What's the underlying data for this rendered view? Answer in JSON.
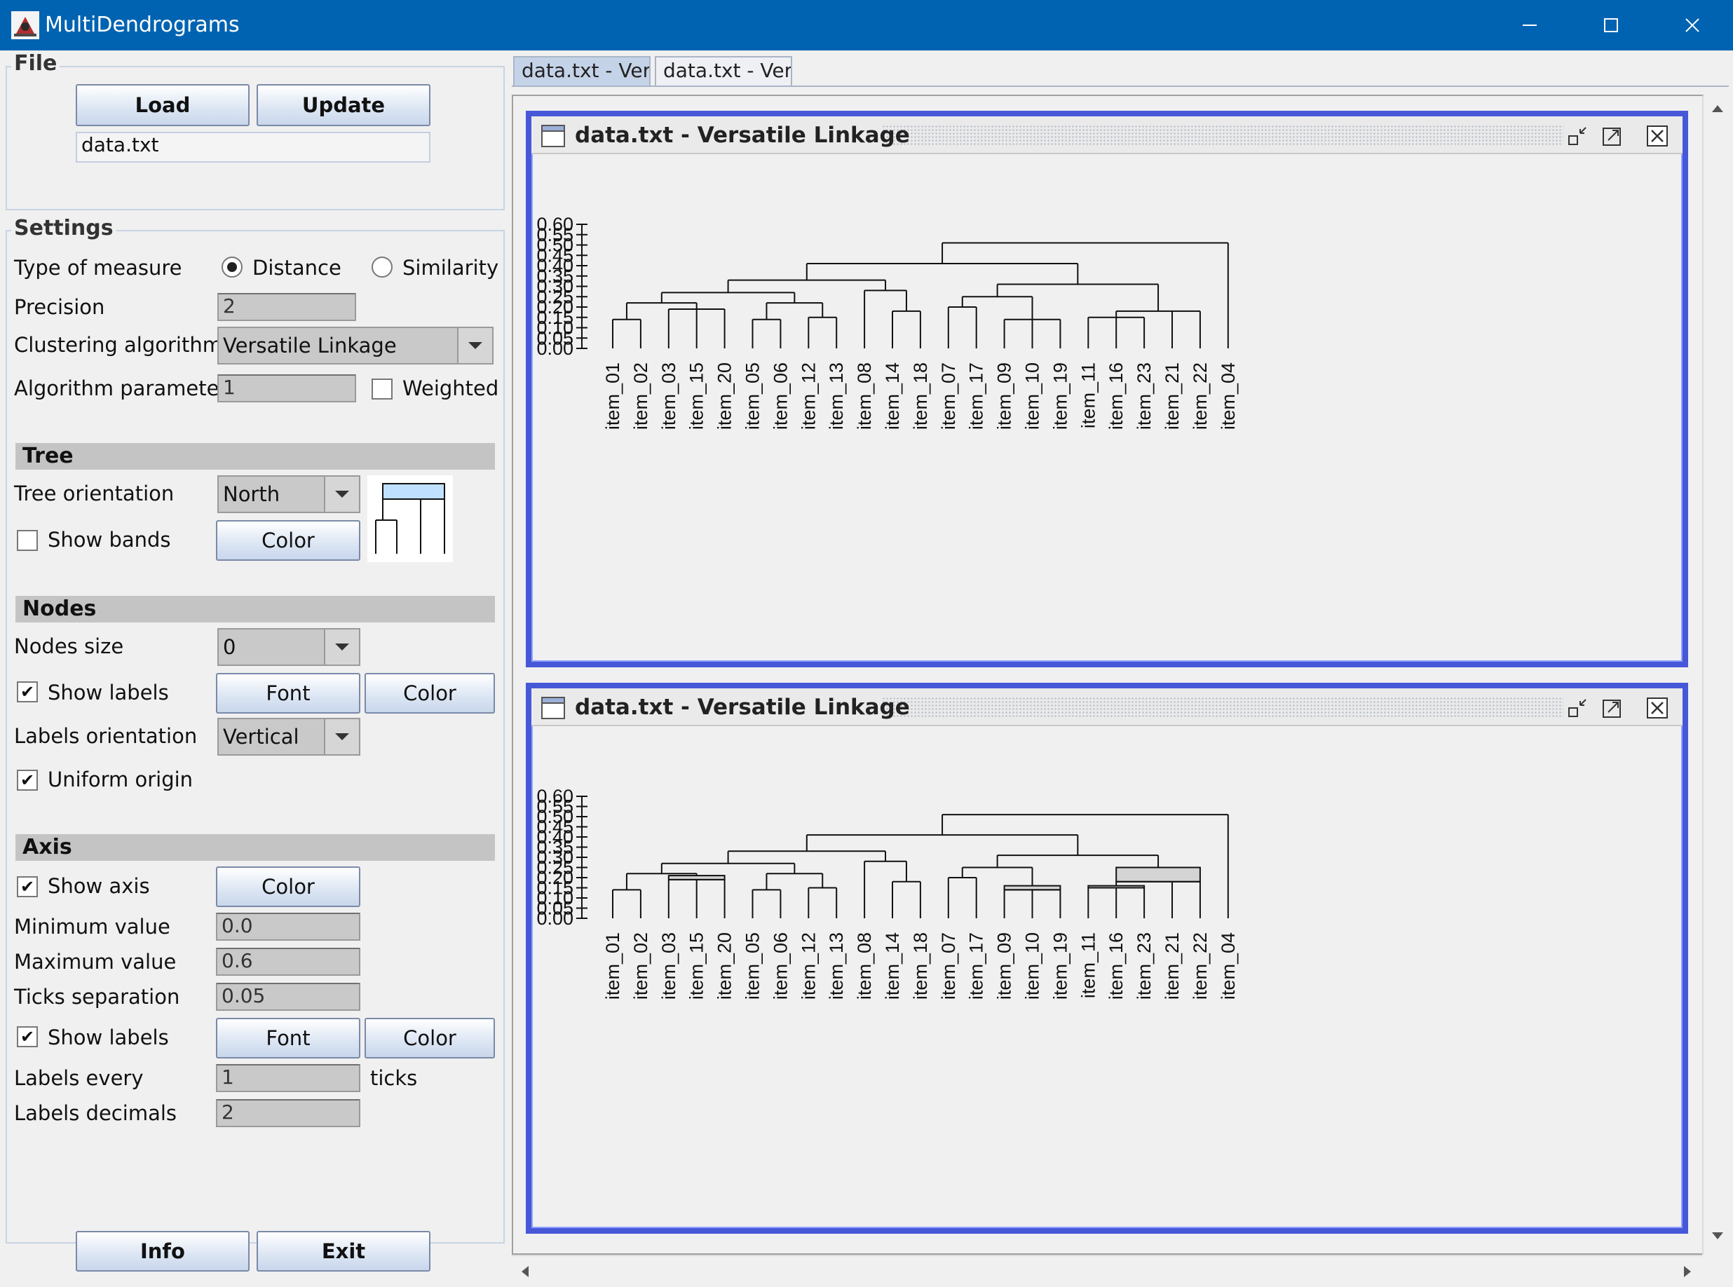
{
  "window": {
    "title": "MultiDendrograms"
  },
  "file": {
    "group_title": "File",
    "load_label": "Load",
    "update_label": "Update",
    "filename": "data.txt"
  },
  "settings": {
    "group_title": "Settings",
    "type_of_measure_label": "Type of measure",
    "distance_label": "Distance",
    "similarity_label": "Similarity",
    "selected_measure": "Distance",
    "precision_label": "Precision",
    "precision_value": "2",
    "algorithm_label": "Clustering algorithm",
    "algorithm_value": "Versatile Linkage",
    "parameter_label": "Algorithm parameter",
    "parameter_value": "1",
    "weighted_label": "Weighted",
    "weighted_checked": false
  },
  "tree": {
    "section_title": "Tree",
    "orientation_label": "Tree orientation",
    "orientation_value": "North",
    "show_bands_label": "Show bands",
    "show_bands_checked": false,
    "color_label": "Color"
  },
  "nodes": {
    "section_title": "Nodes",
    "size_label": "Nodes size",
    "size_value": "0",
    "show_labels_label": "Show labels",
    "show_labels_checked": true,
    "font_label": "Font",
    "color_label": "Color",
    "labels_orientation_label": "Labels orientation",
    "labels_orientation_value": "Vertical",
    "uniform_origin_label": "Uniform origin",
    "uniform_origin_checked": true
  },
  "axis": {
    "section_title": "Axis",
    "show_axis_label": "Show axis",
    "show_axis_checked": true,
    "color_label": "Color",
    "min_label": "Minimum value",
    "min_value": "0.0",
    "max_label": "Maximum value",
    "max_value": "0.6",
    "ticks_label": "Ticks separation",
    "ticks_value": "0.05",
    "show_labels_label": "Show labels",
    "show_labels_checked": true,
    "font_label": "Font",
    "labels_color_label": "Color",
    "labels_every_label": "Labels every",
    "labels_every_value": "1",
    "ticks_suffix": "ticks",
    "decimals_label": "Labels decimals",
    "decimals_value": "2"
  },
  "footer": {
    "info_label": "Info",
    "exit_label": "Exit"
  },
  "tabs": [
    {
      "label": "data.txt - Ver...",
      "active": true
    },
    {
      "label": "data.txt - Ver...",
      "active": false
    }
  ],
  "colors": {
    "titlebar": "#0063b1",
    "frame_border": "#4658d8",
    "band_fill": "#d4d4d4"
  },
  "chart_data": [
    {
      "type": "dendrogram",
      "title": "data.txt - Versatile Linkage",
      "ylim": [
        0,
        0.6
      ],
      "yticks": [
        "0.60",
        "0.55",
        "0.50",
        "0.45",
        "0.40",
        "0.35",
        "0.30",
        "0.25",
        "0.20",
        "0.15",
        "0.10",
        "0.05",
        "0.00"
      ],
      "leaves": [
        "item_01",
        "item_02",
        "item_03",
        "item_15",
        "item_20",
        "item_05",
        "item_06",
        "item_12",
        "item_13",
        "item_08",
        "item_14",
        "item_18",
        "item_07",
        "item_17",
        "item_09",
        "item_10",
        "item_19",
        "item_11",
        "item_16",
        "item_23",
        "item_21",
        "item_22",
        "item_04"
      ],
      "merges": [
        {
          "left": "item_01",
          "right": "item_02",
          "height": 0.14
        },
        {
          "left": "item_03",
          "right": "item_15",
          "right2": "item_20",
          "height": 0.19
        },
        {
          "left": "item_05",
          "right": "item_06",
          "height": 0.14
        },
        {
          "left": "item_12",
          "right": "item_13",
          "height": 0.15
        },
        {
          "left": "item_14",
          "right": "item_18",
          "height": 0.18
        },
        {
          "left": "item_07",
          "right": "item_17",
          "height": 0.2
        },
        {
          "left": "item_09",
          "right": "item_10",
          "right2": "item_19",
          "height": 0.14
        },
        {
          "left": "item_11",
          "right": "item_16",
          "right2": "item_23",
          "height": 0.15
        },
        {
          "left": "[11,16,23]",
          "right": "item_21",
          "right2": "item_22",
          "height": 0.18
        },
        {
          "left": "[01,02]",
          "right": "[03,15,20]",
          "height": 0.22
        },
        {
          "left": "[05,06]",
          "right": "[12,13]",
          "height": 0.22
        },
        {
          "left": "[07,17]",
          "right": "[09,10,19]",
          "height": 0.25
        },
        {
          "left": "item_08",
          "right": "[14,18]",
          "height": 0.28
        },
        {
          "left": "[01..20]",
          "right": "[05..13]",
          "height": 0.27
        },
        {
          "left": "[07..19]",
          "right": "[11..22]",
          "height": 0.31
        },
        {
          "left": "[01..13]",
          "right": "[08,14,18]",
          "height": 0.33
        },
        {
          "left": "[01..18]",
          "right": "[07..22]",
          "height": 0.41
        },
        {
          "left": "[01..22]",
          "right": "item_04",
          "height": 0.51
        }
      ],
      "show_bands": false
    },
    {
      "type": "dendrogram",
      "title": "data.txt - Versatile Linkage",
      "ylim": [
        0,
        0.6
      ],
      "yticks": [
        "0.60",
        "0.55",
        "0.50",
        "0.45",
        "0.40",
        "0.35",
        "0.30",
        "0.25",
        "0.20",
        "0.15",
        "0.10",
        "0.05",
        "0.00"
      ],
      "leaves": [
        "item_01",
        "item_02",
        "item_03",
        "item_15",
        "item_20",
        "item_05",
        "item_06",
        "item_12",
        "item_13",
        "item_08",
        "item_14",
        "item_18",
        "item_07",
        "item_17",
        "item_09",
        "item_10",
        "item_19",
        "item_11",
        "item_16",
        "item_23",
        "item_21",
        "item_22",
        "item_04"
      ],
      "merges": [
        {
          "left": "item_01",
          "right": "item_02",
          "height": 0.14
        },
        {
          "left": "item_03",
          "right": "item_15",
          "right2": "item_20",
          "height": 0.19,
          "band_top": 0.21
        },
        {
          "left": "item_05",
          "right": "item_06",
          "height": 0.14
        },
        {
          "left": "item_12",
          "right": "item_13",
          "height": 0.15
        },
        {
          "left": "item_14",
          "right": "item_18",
          "height": 0.18
        },
        {
          "left": "item_07",
          "right": "item_17",
          "height": 0.2
        },
        {
          "left": "item_09",
          "right": "item_10",
          "right2": "item_19",
          "height": 0.14,
          "band_top": 0.16
        },
        {
          "left": "item_11",
          "right": "item_16",
          "right2": "item_23",
          "height": 0.15,
          "band_top": 0.16
        },
        {
          "left": "[11,16,23]",
          "right": "item_21",
          "right2": "item_22",
          "height": 0.18,
          "band_top": 0.25
        },
        {
          "left": "[01,02]",
          "right": "[03,15,20]",
          "height": 0.22
        },
        {
          "left": "[05,06]",
          "right": "[12,13]",
          "height": 0.22
        },
        {
          "left": "[07,17]",
          "right": "[09,10,19]",
          "height": 0.25
        },
        {
          "left": "item_08",
          "right": "[14,18]",
          "height": 0.28
        },
        {
          "left": "[01..20]",
          "right": "[05..13]",
          "height": 0.27
        },
        {
          "left": "[07..19]",
          "right": "[11..22]",
          "height": 0.31
        },
        {
          "left": "[01..13]",
          "right": "[08,14,18]",
          "height": 0.33
        },
        {
          "left": "[01..18]",
          "right": "[07..22]",
          "height": 0.41
        },
        {
          "left": "[01..22]",
          "right": "item_04",
          "height": 0.51
        }
      ],
      "show_bands": true
    }
  ]
}
